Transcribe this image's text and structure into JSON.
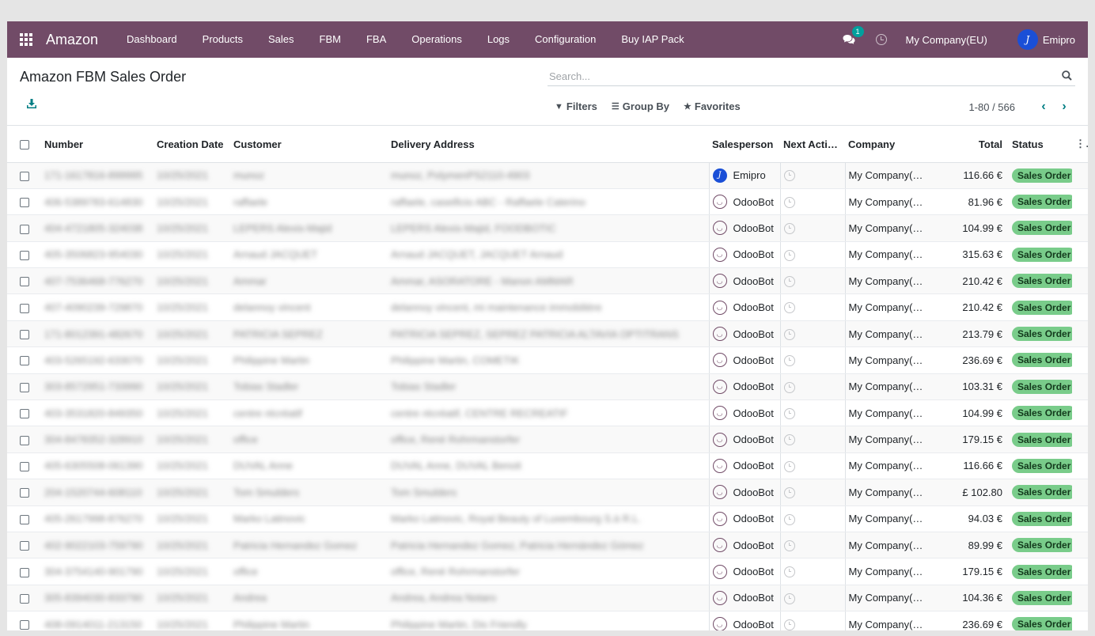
{
  "navbar": {
    "brand": "Amazon",
    "menu": [
      "Dashboard",
      "Products",
      "Sales",
      "FBM",
      "FBA",
      "Operations",
      "Logs",
      "Configuration",
      "Buy IAP Pack"
    ],
    "chat_count": "1",
    "company": "My Company(EU)",
    "user": "Emipro"
  },
  "control_panel": {
    "title": "Amazon FBM Sales Order",
    "search_placeholder": "Search...",
    "filters_label": "Filters",
    "groupby_label": "Group By",
    "favorites_label": "Favorites",
    "pager": "1-80 / 566"
  },
  "table": {
    "headers": {
      "number": "Number",
      "creation_date": "Creation Date",
      "customer": "Customer",
      "delivery_address": "Delivery Address",
      "salesperson": "Salesperson",
      "next_activity": "Next Activity",
      "company": "Company",
      "total": "Total",
      "status": "Status"
    },
    "rows": [
      {
        "number": "171-1617816-899995",
        "date": "10/25/2021",
        "customer": "munoz",
        "address": "munoz, PolymenPS2110-4903",
        "salesperson": "Emipro",
        "company": "My Company(EU)",
        "total": "116.66 €",
        "status": "Sales Order"
      },
      {
        "number": "406-5389783-614830",
        "date": "10/25/2021",
        "customer": "raffaele",
        "address": "raffaele, caseificio ABC - Raffaele Caterino",
        "salesperson": "OdooBot",
        "company": "My Company(EU)",
        "total": "81.96 €",
        "status": "Sales Order"
      },
      {
        "number": "404-4721805-324038",
        "date": "10/25/2021",
        "customer": "LEPERS Alexis-Majid",
        "address": "LEPERS Alexis-Majid, FOODBOTIC",
        "salesperson": "OdooBot",
        "company": "My Company(EU)",
        "total": "104.99 €",
        "status": "Sales Order"
      },
      {
        "number": "405-3506823-954030",
        "date": "10/25/2021",
        "customer": "Arnaud JACQUET",
        "address": "Arnaud JACQUET, JACQUET Arnaud",
        "salesperson": "OdooBot",
        "company": "My Company(EU)",
        "total": "315.63 €",
        "status": "Sales Order"
      },
      {
        "number": "407-7536468-776270",
        "date": "10/25/2021",
        "customer": "Ammar",
        "address": "Ammar, ASORATORE - Manon AMMAR",
        "salesperson": "OdooBot",
        "company": "My Company(EU)",
        "total": "210.42 €",
        "status": "Sales Order"
      },
      {
        "number": "407-4090239-729870",
        "date": "10/25/2021",
        "customer": "delannoy vincent",
        "address": "delannoy vincent, mi maintenance immobilière",
        "salesperson": "OdooBot",
        "company": "My Company(EU)",
        "total": "210.42 €",
        "status": "Sales Order"
      },
      {
        "number": "171-8012391-482670",
        "date": "10/25/2021",
        "customer": "PATRICIA SEPREZ",
        "address": "PATRICIA SEPREZ, SEPREZ PATRICIA ALTAVIA OPTITRANS",
        "salesperson": "OdooBot",
        "company": "My Company(EU)",
        "total": "213.79 €",
        "status": "Sales Order"
      },
      {
        "number": "403-5265192-633070",
        "date": "10/25/2021",
        "customer": "Philippine Martin",
        "address": "Philippine Martin, COMETIK",
        "salesperson": "OdooBot",
        "company": "My Company(EU)",
        "total": "236.69 €",
        "status": "Sales Order"
      },
      {
        "number": "303-8572951-733990",
        "date": "10/25/2021",
        "customer": "Tobias Stadler",
        "address": "Tobias Stadler",
        "salesperson": "OdooBot",
        "company": "My Company(EU)",
        "total": "103.31 €",
        "status": "Sales Order"
      },
      {
        "number": "403-3531820-849350",
        "date": "10/25/2021",
        "customer": "centre récréatif",
        "address": "centre récréatif, CENTRE RECREATIF",
        "salesperson": "OdooBot",
        "company": "My Company(EU)",
        "total": "104.99 €",
        "status": "Sales Order"
      },
      {
        "number": "304-8478352-328910",
        "date": "10/25/2021",
        "customer": "office",
        "address": "office, René Rohrmanstorfer",
        "salesperson": "OdooBot",
        "company": "My Company(EU)",
        "total": "179.15 €",
        "status": "Sales Order"
      },
      {
        "number": "405-6305508-061390",
        "date": "10/25/2021",
        "customer": "DUVAL Anne",
        "address": "DUVAL Anne, DUVAL Benoit",
        "salesperson": "OdooBot",
        "company": "My Company(EU)",
        "total": "116.66 €",
        "status": "Sales Order"
      },
      {
        "number": "204-1520744-608110",
        "date": "10/25/2021",
        "customer": "Tom Smulders",
        "address": "Tom Smulders",
        "salesperson": "OdooBot",
        "company": "My Company(EU)",
        "total": "£ 102.80",
        "status": "Sales Order"
      },
      {
        "number": "405-2617998-876270",
        "date": "10/25/2021",
        "customer": "Marko Latinovic",
        "address": "Marko Latinovic, Royal Beauty of Luxembourg S.à R.L.",
        "salesperson": "OdooBot",
        "company": "My Company(EU)",
        "total": "94.03 €",
        "status": "Sales Order"
      },
      {
        "number": "402-9022103-759790",
        "date": "10/25/2021",
        "customer": "Patricia Hernandez Gomez",
        "address": "Patricia Hernandez Gomez, Patricia Hernández Gómez",
        "salesperson": "OdooBot",
        "company": "My Company(EU)",
        "total": "89.99 €",
        "status": "Sales Order"
      },
      {
        "number": "304-3754140-901790",
        "date": "10/25/2021",
        "customer": "office",
        "address": "office, René Rohrmanstorfer",
        "salesperson": "OdooBot",
        "company": "My Company(EU)",
        "total": "179.15 €",
        "status": "Sales Order"
      },
      {
        "number": "305-8394030-833790",
        "date": "10/25/2021",
        "customer": "Andrea",
        "address": "Andrea, Andrea Notaro",
        "salesperson": "OdooBot",
        "company": "My Company(EU)",
        "total": "104.36 €",
        "status": "Sales Order"
      },
      {
        "number": "408-0914011-213150",
        "date": "10/25/2021",
        "customer": "Philippine Martin",
        "address": "Philippine Martin, Dis Friendly",
        "salesperson": "OdooBot",
        "company": "My Company(EU)",
        "total": "236.69 €",
        "status": "Sales Order"
      }
    ]
  },
  "colors": {
    "navbar": "#714b67",
    "status_badge": "#79cc8a",
    "pager_arrow": "#017e84"
  }
}
